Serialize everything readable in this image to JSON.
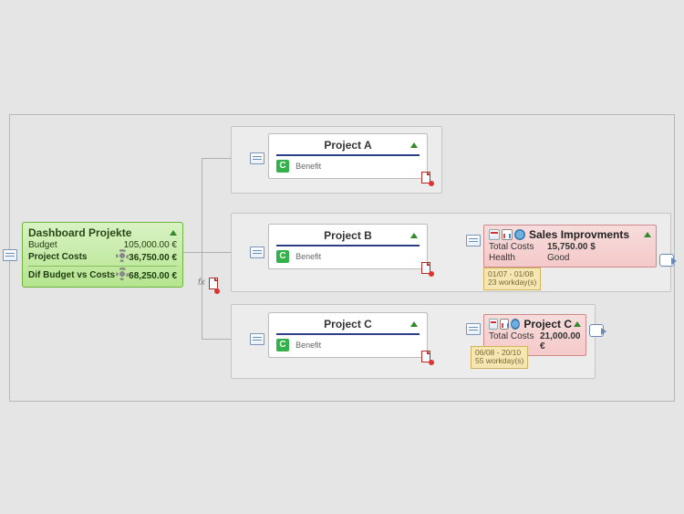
{
  "dashboard": {
    "title": "Dashboard Projekte",
    "rows": {
      "budget_label": "Budget",
      "budget_value": "105,000.00 €",
      "costs_label": "Project Costs",
      "costs_value": "36,750.00 €",
      "dif_label": "Dif Budget vs Costs",
      "dif_value": "68,250.00 €"
    }
  },
  "fx_label": "fx",
  "projects": {
    "a": {
      "title": "Project A",
      "benefit": "Benefit",
      "badge": "C"
    },
    "b": {
      "title": "Project B",
      "benefit": "Benefit",
      "badge": "C"
    },
    "c": {
      "title": "Project C",
      "benefit": "Benefit",
      "badge": "C"
    }
  },
  "details": {
    "sales": {
      "title": "Sales Improvments",
      "cost_label": "Total Costs",
      "cost_value": "15,750.00 $",
      "health_label": "Health",
      "health_value": "Good",
      "period_line1": "01/07 - 01/08",
      "period_line2": "23 workday(s)"
    },
    "projc": {
      "title": "Project C",
      "cost_label": "Total Costs",
      "cost_value": "21,000.00 €",
      "period_line1": "06/08 - 20/10",
      "period_line2": "55 workday(s)"
    }
  }
}
